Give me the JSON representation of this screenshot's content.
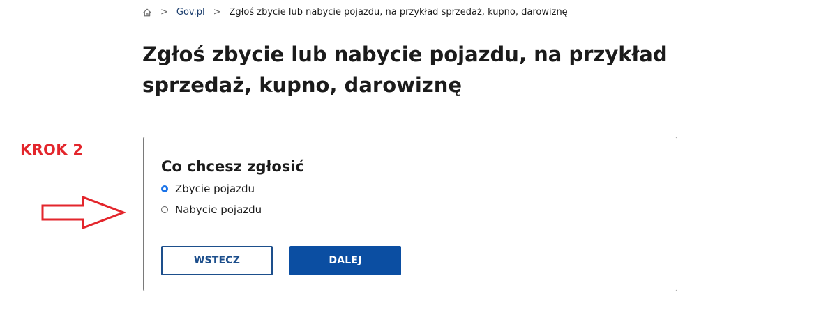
{
  "breadcrumb": {
    "home_icon": "home-icon",
    "separator": ">",
    "items": [
      {
        "label": "Gov.pl"
      },
      {
        "label": "Zgłoś zbycie lub nabycie pojazdu, na przykład sprzedaż, kupno, darowiznę"
      }
    ]
  },
  "page": {
    "title": "Zgłoś zbycie lub nabycie pojazdu, na przykład sprzedaż, kupno, darowiznę"
  },
  "annotation": {
    "step_label": "KROK 2",
    "arrow_icon": "arrow-right-icon",
    "color": "#e3262c"
  },
  "form": {
    "title": "Co chcesz zgłosić",
    "options": [
      {
        "label": "Zbycie pojazdu",
        "selected": true
      },
      {
        "label": "Nabycie pojazdu",
        "selected": false
      }
    ],
    "back_label": "WSTECZ",
    "next_label": "DALEJ"
  },
  "colors": {
    "primary": "#0b4ea2",
    "link": "#1d3f6e",
    "radio_checked": "#1a73e8",
    "annotation": "#e3262c"
  }
}
